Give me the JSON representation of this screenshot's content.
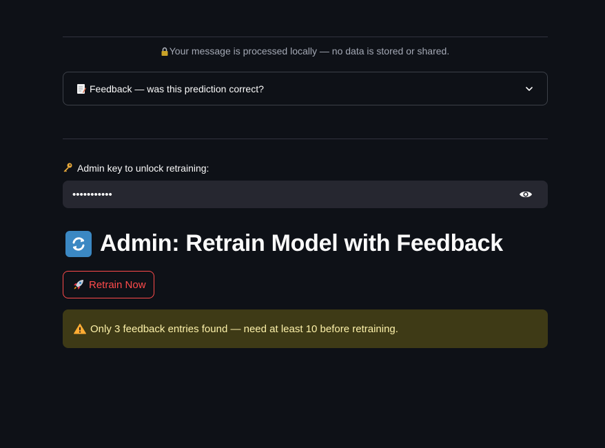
{
  "privacy_caption": "Your message is processed locally — no data is stored or shared.",
  "feedback_expander": {
    "icon": "memo-icon",
    "label": "Feedback — was this prediction correct?"
  },
  "admin_key": {
    "icon": "key-icon",
    "label": "Admin key to unlock retraining:",
    "value": "•••••••••••"
  },
  "retrain_section": {
    "icon": "refresh-icon",
    "title": "Admin: Retrain Model with Feedback",
    "button_icon": "rocket-icon",
    "button_label": "Retrain Now"
  },
  "warning": {
    "icon": "warning-icon",
    "message": "Only 3 feedback entries found — need at least 10 before retraining."
  },
  "colors": {
    "background": "#0e1117",
    "accent": "#ff4b4b",
    "warning_bg": "#3e3a16",
    "warning_text": "#fdf1a9"
  }
}
